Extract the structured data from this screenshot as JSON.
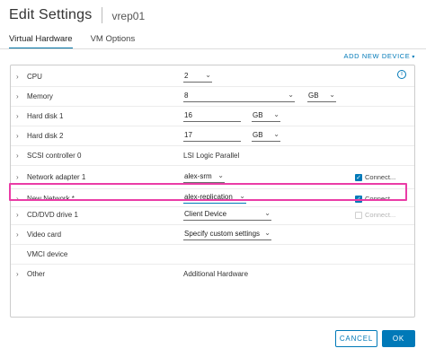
{
  "header": {
    "title": "Edit Settings",
    "vm_name": "vrep01"
  },
  "tabs": [
    {
      "label": "Virtual Hardware",
      "active": true
    },
    {
      "label": "VM Options",
      "active": false
    }
  ],
  "add_device": {
    "label": "ADD NEW DEVICE",
    "caret": "▾"
  },
  "info_icon": {
    "glyph": "i",
    "icon": "info-icon"
  },
  "rows": {
    "cpu": {
      "label": "CPU",
      "value": "2"
    },
    "memory": {
      "label": "Memory",
      "value": "8",
      "unit": "GB"
    },
    "hard_disk_1": {
      "label": "Hard disk 1",
      "value": "16",
      "unit": "GB"
    },
    "hard_disk_2": {
      "label": "Hard disk 2",
      "value": "17",
      "unit": "GB"
    },
    "scsi": {
      "label": "SCSI controller 0",
      "value": "LSI Logic Parallel"
    },
    "network_adapter_1": {
      "label": "Network adapter 1",
      "value": "alex-srm",
      "connect": "Connect...",
      "connected": true
    },
    "new_network": {
      "label": "New Network *",
      "value": "alex-replication",
      "connect": "Connect...",
      "connected": true
    },
    "cd_dvd": {
      "label": "CD/DVD drive 1",
      "value": "Client Device",
      "connect": "Connect...",
      "connected": false
    },
    "video_card": {
      "label": "Video card",
      "value": "Specify custom settings"
    },
    "vmci": {
      "label": "VMCI device"
    },
    "other": {
      "label": "Other",
      "value": "Additional Hardware"
    }
  },
  "glyphs": {
    "chevron": "›",
    "caret": "⌄",
    "check": "✓"
  },
  "buttons": {
    "cancel": "CANCEL",
    "ok": "OK"
  },
  "colors": {
    "accent": "#0079b8",
    "highlight": "#ea3ca6"
  }
}
